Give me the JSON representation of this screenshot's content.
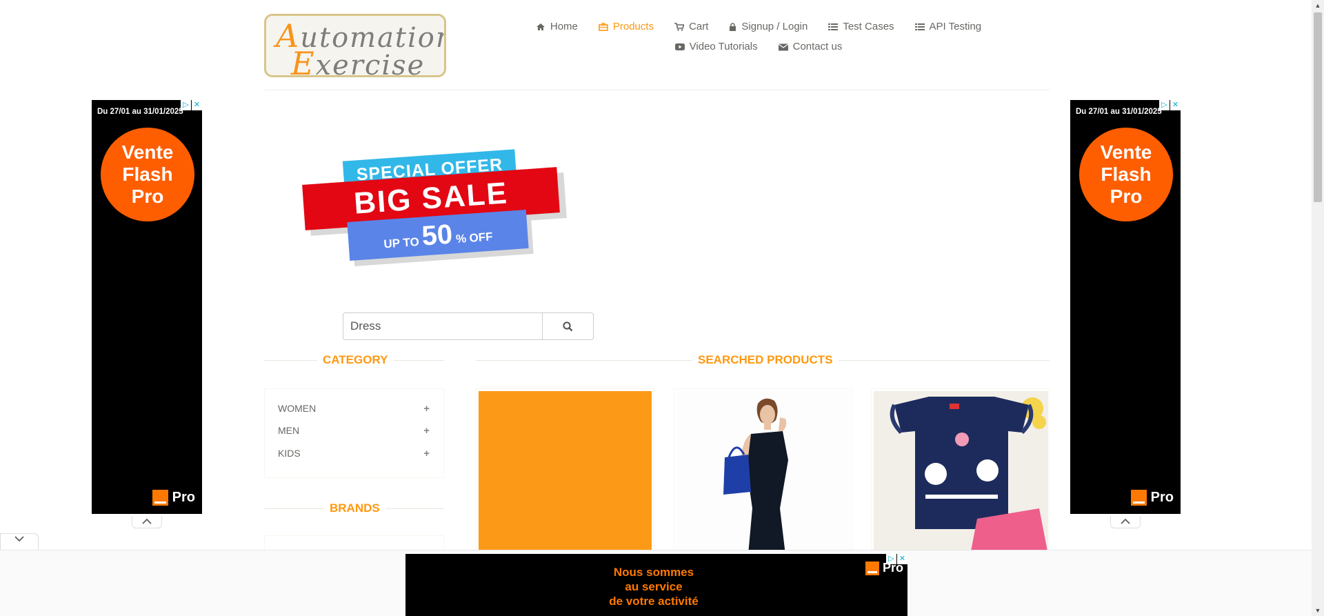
{
  "logo": {
    "line1_cap": "A",
    "line1_rest": "utomation",
    "line2_cap": "E",
    "line2_rest": "xercise"
  },
  "nav": {
    "row1": [
      {
        "icon": "home-icon",
        "glyph": "⌂",
        "label": "Home"
      },
      {
        "icon": "briefcase-icon",
        "glyph": "▣",
        "label": "Products",
        "active": true
      },
      {
        "icon": "cart-icon",
        "glyph": "⛟",
        "label": "Cart"
      },
      {
        "icon": "lock-icon",
        "glyph": "🔒",
        "label": "Signup / Login"
      },
      {
        "icon": "list-icon",
        "glyph": "☰",
        "label": "Test Cases"
      },
      {
        "icon": "list-icon",
        "glyph": "☰",
        "label": "API Testing"
      }
    ],
    "row2": [
      {
        "icon": "youtube-icon",
        "glyph": "▶",
        "label": "Video Tutorials"
      },
      {
        "icon": "envelope-icon",
        "glyph": "✉",
        "label": "Contact us"
      }
    ]
  },
  "side_ad": {
    "date": "Du 27/01 au 31/01/2025",
    "circle_line1": "Vente",
    "circle_line2": "Flash",
    "circle_line3": "Pro",
    "brand": "Pro"
  },
  "banner": {
    "top": "SPECIAL OFFER",
    "middle": "BIG SALE",
    "bottom_small1": "UP",
    "bottom_small2": "TO",
    "bottom_big": "50",
    "bottom_small3": "%",
    "bottom_small4": "OFF"
  },
  "search": {
    "value": "Dress"
  },
  "sidebar": {
    "category_title": "Category",
    "categories": [
      "WOMEN",
      "MEN",
      "KIDS"
    ],
    "brands_title": "Brands"
  },
  "main": {
    "title": "Searched Products"
  },
  "bottom_ad": {
    "line1": "Nous sommes",
    "line2": "au service",
    "line3": "de votre activité",
    "brand": "Pro"
  },
  "colors": {
    "accent": "#fe980f",
    "ad_orange": "#ff7900",
    "sale_red": "#e30613",
    "sale_blue": "#5a84e8",
    "sale_cyan": "#31b8e8"
  }
}
